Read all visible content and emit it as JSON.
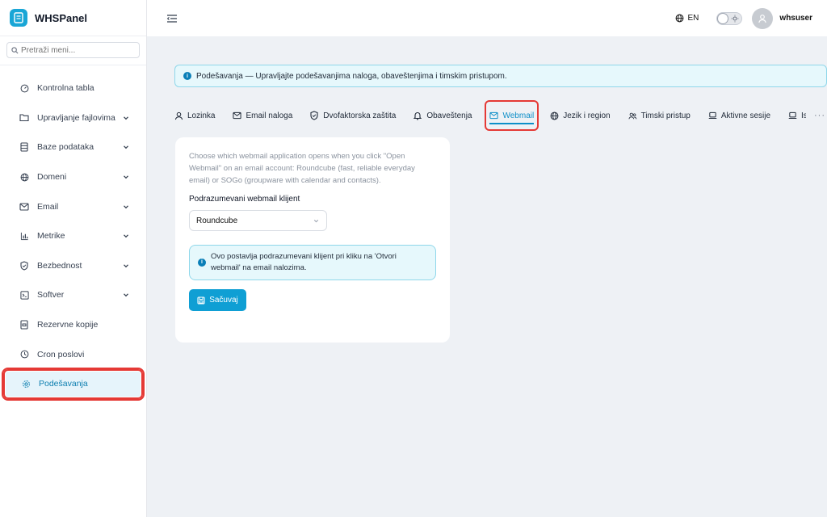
{
  "app": {
    "name": "WHSPanel"
  },
  "search": {
    "placeholder": "Pretraži meni..."
  },
  "sidebar": {
    "items": [
      {
        "label": "Kontrolna tabla"
      },
      {
        "label": "Upravljanje fajlovima"
      },
      {
        "label": "Baze podataka"
      },
      {
        "label": "Domeni"
      },
      {
        "label": "Email"
      },
      {
        "label": "Metrike"
      },
      {
        "label": "Bezbednost"
      },
      {
        "label": "Softver"
      },
      {
        "label": "Rezervne kopije"
      },
      {
        "label": "Cron poslovi"
      },
      {
        "label": "Podešavanja"
      }
    ]
  },
  "header": {
    "language": "EN",
    "username": "whsuser"
  },
  "banner": {
    "text": "Podešavanja — Upravljajte podešavanjima naloga, obaveštenjima i timskim pristupom."
  },
  "tabs": [
    {
      "label": "Lozinka"
    },
    {
      "label": "Email naloga"
    },
    {
      "label": "Dvofaktorska zaštita"
    },
    {
      "label": "Obaveštenja"
    },
    {
      "label": "Webmail"
    },
    {
      "label": "Jezik i region"
    },
    {
      "label": "Timski pristup"
    },
    {
      "label": "Aktivne sesije"
    },
    {
      "label": "Is"
    }
  ],
  "more_tabs": "···",
  "webmail": {
    "description": "Choose which webmail application opens when you click \"Open Webmail\" on an email account: Roundcube (fast, reliable everyday email) or SOGo (groupware with calendar and contacts).",
    "field_label": "Podrazumevani webmail klijent",
    "selected_client": "Roundcube",
    "note": "Ovo postavlja podrazumevani klijent pri kliku na 'Otvori webmail' na email nalozima.",
    "save_label": "Sačuvaj"
  }
}
